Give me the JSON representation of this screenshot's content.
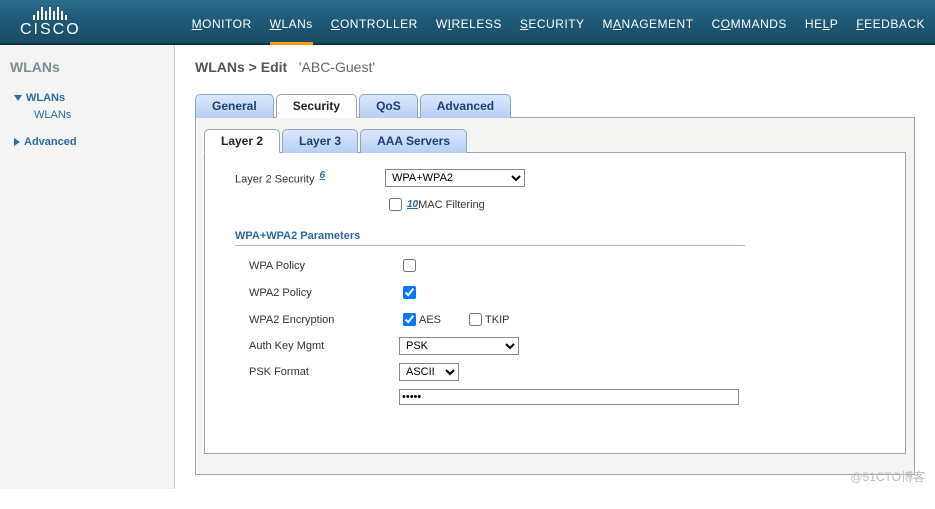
{
  "brand": "CISCO",
  "nav": {
    "monitor": "MONITOR",
    "wlans": "WLANs",
    "controller": "CONTROLLER",
    "wireless": "WIRELESS",
    "security": "SECURITY",
    "management": "MANAGEMENT",
    "commands": "COMMANDS",
    "help": "HELP",
    "feedback": "FEEDBACK"
  },
  "sidebar": {
    "title": "WLANs",
    "items": [
      {
        "label": "WLANs",
        "expanded": true,
        "children": [
          {
            "label": "WLANs"
          }
        ]
      },
      {
        "label": "Advanced",
        "expanded": false
      }
    ]
  },
  "breadcrumb": {
    "root": "WLANs",
    "action": "Edit",
    "target": "'ABC-Guest'"
  },
  "tabs": {
    "general": "General",
    "security": "Security",
    "qos": "QoS",
    "advanced": "Advanced",
    "active": "security"
  },
  "subtabs": {
    "layer2": "Layer 2",
    "layer3": "Layer 3",
    "aaa": "AAA Servers",
    "active": "layer2"
  },
  "form": {
    "layer2_security_label": "Layer 2 Security",
    "layer2_security_note": "6",
    "layer2_security_value": "WPA+WPA2",
    "mac_filtering_note": "10",
    "mac_filtering_label": "MAC Filtering",
    "mac_filtering_checked": false,
    "section_heading": "WPA+WPA2 Parameters",
    "wpa_policy_label": "WPA Policy",
    "wpa_policy_checked": false,
    "wpa2_policy_label": "WPA2 Policy",
    "wpa2_policy_checked": true,
    "wpa2_encryption_label": "WPA2 Encryption",
    "aes_label": "AES",
    "aes_checked": true,
    "tkip_label": "TKIP",
    "tkip_checked": false,
    "auth_key_mgmt_label": "Auth Key Mgmt",
    "auth_key_mgmt_value": "PSK",
    "psk_format_label": "PSK Format",
    "psk_format_value": "ASCII",
    "psk_value": "•••••"
  },
  "watermark": "@51CTO博客"
}
